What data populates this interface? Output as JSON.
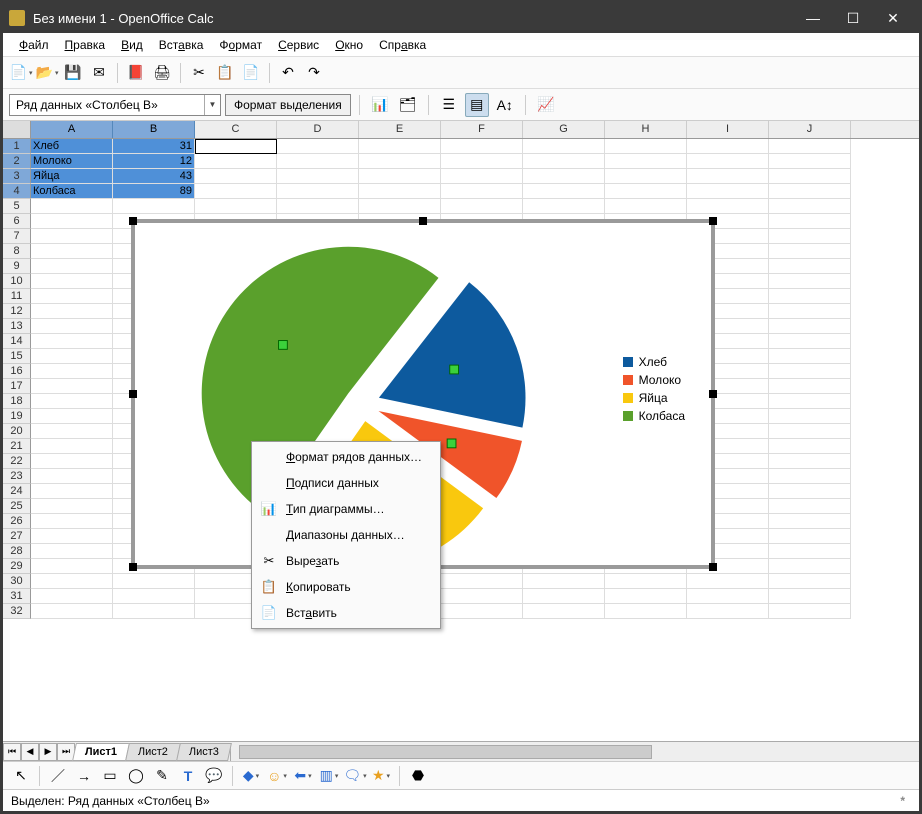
{
  "window": {
    "title": "Без имени 1 - OpenOffice Calc"
  },
  "win_controls": {
    "min": "—",
    "max": "☐",
    "close": "✕"
  },
  "menu": [
    "Файл",
    "Правка",
    "Вид",
    "Вставка",
    "Формат",
    "Сервис",
    "Окно",
    "Справка"
  ],
  "name_box": {
    "value": "Ряд данных «Столбец B»"
  },
  "format_selection_btn": "Формат выделения",
  "columns": [
    "A",
    "B",
    "C",
    "D",
    "E",
    "F",
    "G",
    "H",
    "I",
    "J"
  ],
  "rows": [
    "1",
    "2",
    "3",
    "4",
    "5",
    "6",
    "7",
    "8",
    "9",
    "10",
    "11",
    "12",
    "13",
    "14",
    "15",
    "16",
    "17",
    "18",
    "19",
    "20",
    "21",
    "22",
    "23",
    "24",
    "25",
    "26",
    "27",
    "28",
    "29",
    "30",
    "31",
    "32"
  ],
  "cells": {
    "A1": "Хлеб",
    "B1": "31",
    "A2": "Молоко",
    "B2": "12",
    "A3": "Яйца",
    "B3": "43",
    "A4": "Колбаса",
    "B4": "89"
  },
  "chart_data": {
    "type": "pie",
    "categories": [
      "Хлеб",
      "Молоко",
      "Яйца",
      "Колбаса"
    ],
    "values": [
      31,
      12,
      43,
      89
    ],
    "colors": [
      "#0d5a9e",
      "#f0542a",
      "#f9c80e",
      "#5aa02c"
    ],
    "exploded": true,
    "legend_position": "right"
  },
  "legend": [
    {
      "label": "Хлеб",
      "color": "#0d5a9e"
    },
    {
      "label": "Молоко",
      "color": "#f0542a"
    },
    {
      "label": "Яйца",
      "color": "#f9c80e"
    },
    {
      "label": "Колбаса",
      "color": "#5aa02c"
    }
  ],
  "context_menu": {
    "items": [
      {
        "label": "Формат рядов данных…",
        "icon": ""
      },
      {
        "label": "Подписи данных",
        "icon": "",
        "highlight": true
      },
      {
        "label": "Тип диаграммы…",
        "icon": "📊"
      },
      {
        "label": "Диапазоны данных…",
        "icon": ""
      },
      {
        "label": "Вырезать",
        "icon": "✂"
      },
      {
        "label": "Копировать",
        "icon": "📋"
      },
      {
        "label": "Вставить",
        "icon": "📄"
      }
    ]
  },
  "sheets": [
    "Лист1",
    "Лист2",
    "Лист3"
  ],
  "status": {
    "text": "Выделен: Ряд данных «Столбец B»",
    "mark": "*"
  }
}
